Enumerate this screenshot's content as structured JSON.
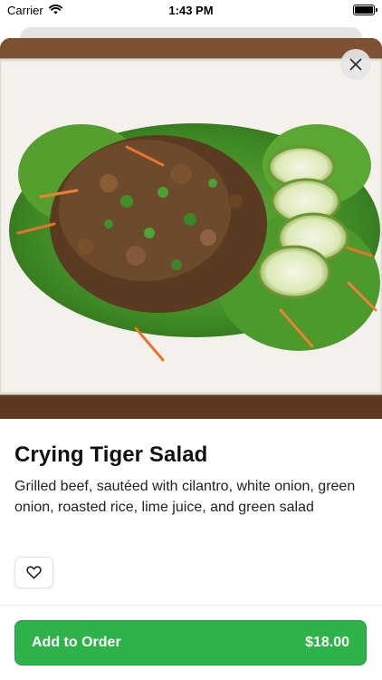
{
  "status_bar": {
    "carrier": "Carrier",
    "time": "1:43 PM"
  },
  "item": {
    "title": "Crying Tiger Salad",
    "description": "Grilled beef, sautéed with cilantro, white onion, green onion, roasted rice, lime juice, and green salad",
    "image_subject": "Crying Tiger Salad dish photo"
  },
  "actions": {
    "add_to_order_label": "Add to Order",
    "price": "$18.00"
  },
  "icons": {
    "close": "close-icon",
    "favorite": "heart-outline-icon",
    "wifi": "wifi-icon",
    "battery": "battery-icon"
  },
  "colors": {
    "accent": "#2db34a",
    "accent_border": "#249a3e",
    "text": "#111111",
    "background": "#ffffff"
  }
}
